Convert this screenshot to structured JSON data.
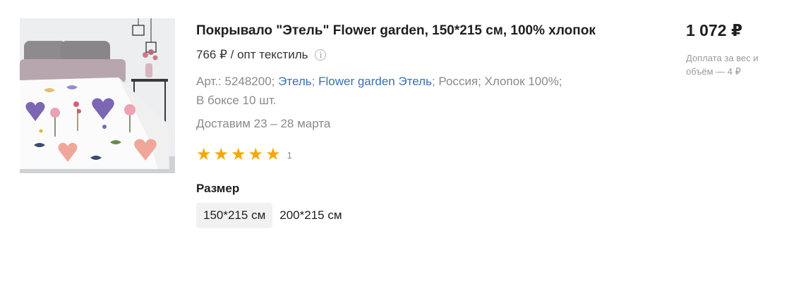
{
  "product": {
    "image_alt": "Покрывало Этель Flower garden",
    "title": "Покрывало \"Этель\" Flower garden, 150*215 см, 100% хлопок",
    "wholesale_price": "766 ₽ / опт текстиль",
    "info_icon_glyph": "i",
    "meta": {
      "article": "Арт.: 5248200;",
      "brand_link": "Этель",
      "sep1": ";",
      "collection_link": "Flower garden Этель",
      "rest": "; Россия; Хлопок 100%;",
      "box": "В боксе 10 шт."
    },
    "delivery": "Доставим 23 – 28 марта",
    "rating": {
      "stars": 5,
      "max": 5,
      "count": "1"
    },
    "size": {
      "label": "Размер",
      "options": [
        "150*215 см",
        "200*215 см"
      ],
      "selected": "150*215 см"
    },
    "price": "1 072 ₽",
    "surcharge": "Доплата за вес и объём — 4 ₽"
  },
  "colors": {
    "link": "#3a6fb0",
    "star": "#f6a700",
    "muted": "#8a8a8a"
  }
}
